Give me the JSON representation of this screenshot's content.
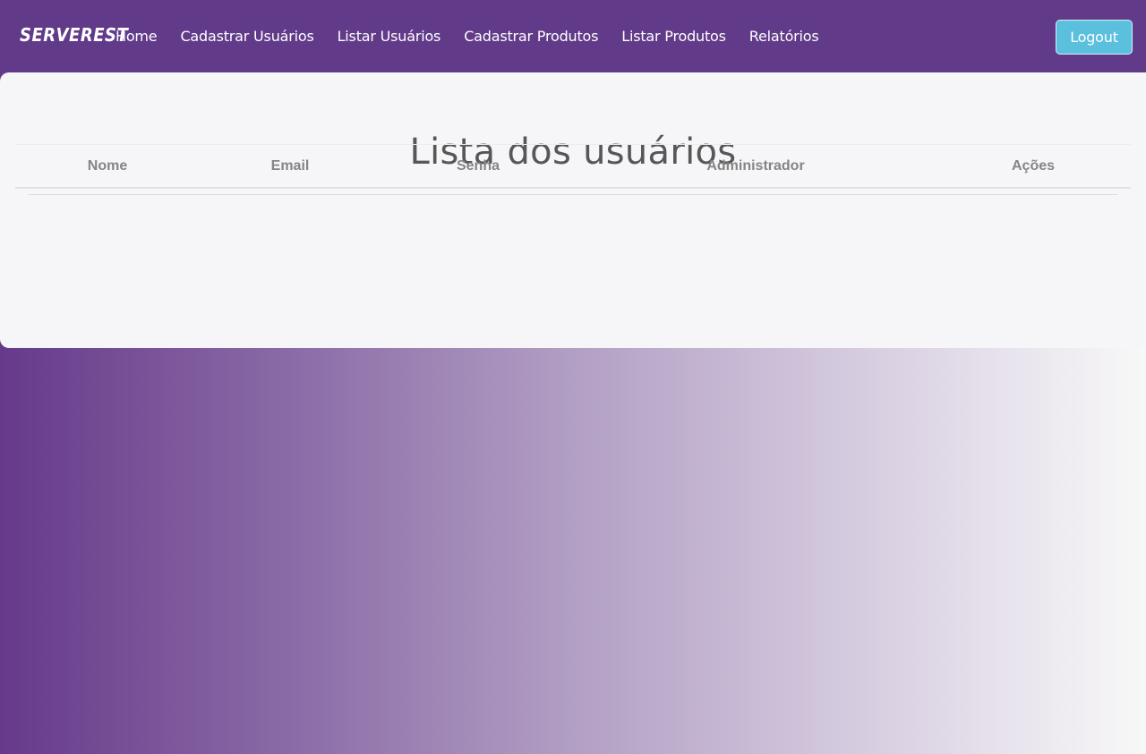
{
  "navbar": {
    "brand": "SERVEREST",
    "links": [
      {
        "label": "Home"
      },
      {
        "label": "Cadastrar Usuários"
      },
      {
        "label": "Listar Usuários"
      },
      {
        "label": "Cadastrar Produtos"
      },
      {
        "label": "Listar Produtos"
      },
      {
        "label": "Relatórios"
      }
    ],
    "logout_label": "Logout"
  },
  "main": {
    "title": "Lista dos usuários",
    "table": {
      "columns": [
        "Nome",
        "Email",
        "Senha",
        "Administrador",
        "Ações"
      ],
      "rows": []
    }
  },
  "colors": {
    "navbar_bg": "#613a89",
    "logout_bg": "#5bc0de",
    "panel_bg": "#f6f6f8",
    "title_text": "#575757",
    "header_text": "#858585"
  }
}
